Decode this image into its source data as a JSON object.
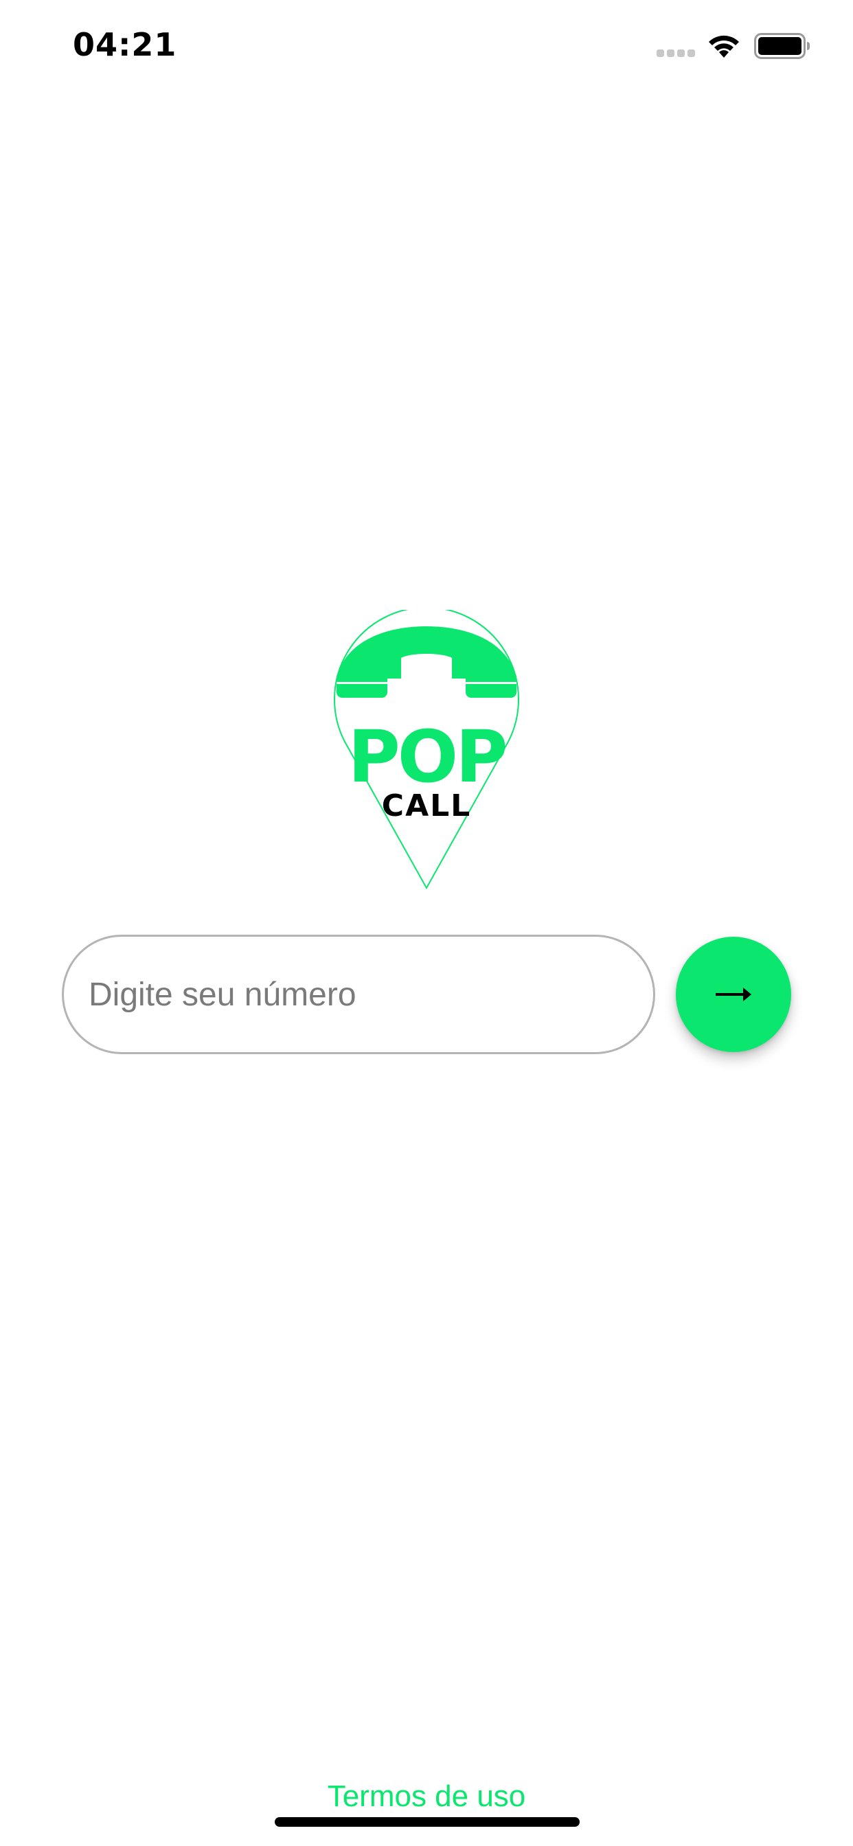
{
  "status_bar": {
    "time": "04:21",
    "icons": [
      "cellular-signal-icon",
      "wifi-icon",
      "battery-icon"
    ]
  },
  "logo": {
    "brand_top": "POP",
    "brand_bottom": "CALL",
    "icon": "phone-handset-pin-icon"
  },
  "phone_input": {
    "placeholder": "Digite seu número",
    "value": ""
  },
  "submit_button": {
    "icon": "arrow-right-icon"
  },
  "footer": {
    "terms_label": "Termos de uso"
  },
  "colors": {
    "accent": "#0ae66e",
    "input_border": "#b4b4b4",
    "placeholder": "#7a7a7a",
    "background": "#ffffff"
  }
}
